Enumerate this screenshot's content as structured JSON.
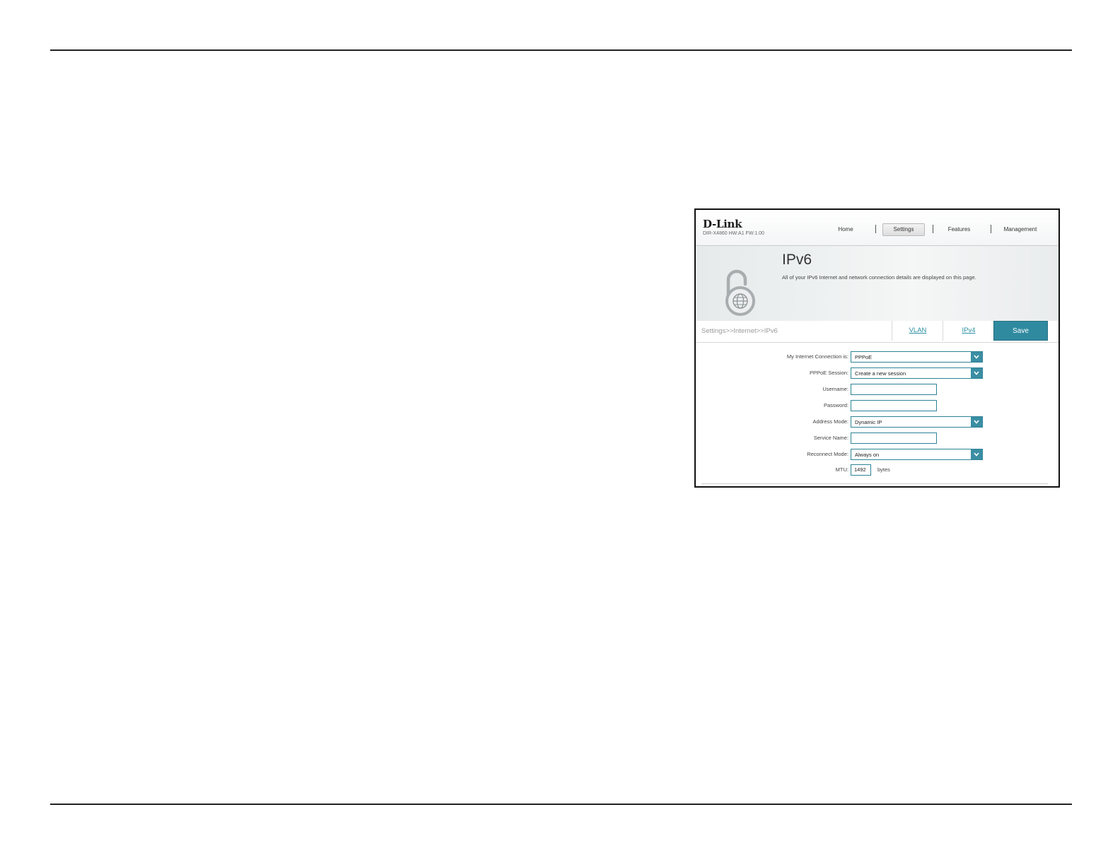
{
  "header": {
    "logo": "D-Link",
    "model": "DIR-X4860 HW:A1 FW:1.00",
    "nav": [
      "Home",
      "Settings",
      "Features",
      "Management"
    ]
  },
  "banner": {
    "title": "IPv6",
    "description": "All of your IPv6 Internet and network connection details are displayed on this page."
  },
  "subnav": {
    "breadcrumb": "Settings>>Internet>>IPv6",
    "tabs": [
      "VLAN",
      "IPv4"
    ],
    "save_label": "Save"
  },
  "form": {
    "connection_label": "My Internet Connection is:",
    "connection_value": "PPPoE",
    "session_label": "PPPoE Session:",
    "session_value": "Create a new session",
    "username_label": "Username:",
    "username_value": "",
    "password_label": "Password:",
    "password_value": "",
    "address_mode_label": "Address Mode:",
    "address_mode_value": "Dynamic IP",
    "service_name_label": "Service Name:",
    "service_name_value": "",
    "reconnect_label": "Reconnect Mode:",
    "reconnect_value": "Always on",
    "mtu_label": "MTU:",
    "mtu_value": "1492",
    "mtu_unit": "bytes"
  },
  "colors": {
    "accent": "#2f8aa0",
    "link": "#2a8fa3"
  }
}
